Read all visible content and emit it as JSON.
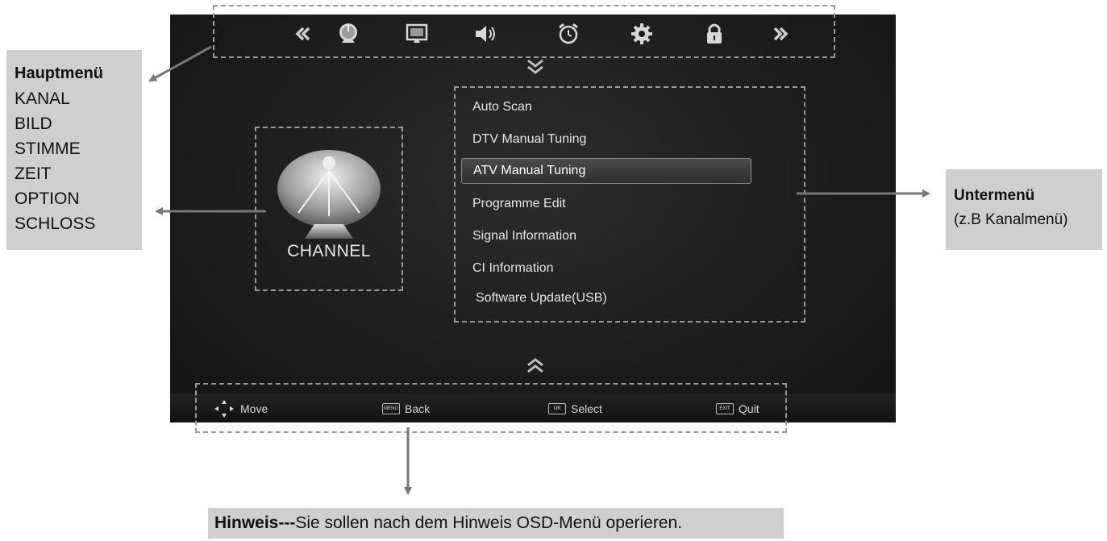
{
  "top_menu": {
    "icons": [
      "double-left-arrow-icon",
      "satellite-dish-icon",
      "monitor-picture-icon",
      "speaker-icon",
      "alarm-clock-icon",
      "gear-icon",
      "padlock-icon",
      "double-right-arrow-icon"
    ]
  },
  "left_panel": {
    "title": "CHANNEL",
    "icon": "satellite-dish-icon"
  },
  "submenu": {
    "items": [
      {
        "label": "Auto Scan",
        "selected": false
      },
      {
        "label": "DTV Manual Tuning",
        "selected": false
      },
      {
        "label": "ATV Manual Tuning",
        "selected": true
      },
      {
        "label": "Programme Edit",
        "selected": false
      },
      {
        "label": "Signal Information",
        "selected": false
      },
      {
        "label": "CI Information",
        "selected": false
      },
      {
        "label": "Software Update(USB)",
        "selected": false
      }
    ]
  },
  "footer": {
    "move_label": "Move",
    "back_label": "Back",
    "back_key": "MENU",
    "select_label": "Select",
    "select_key": "OK",
    "quit_label": "Quit",
    "quit_key": "EXIT"
  },
  "callouts": {
    "main_menu": {
      "heading": "Hauptmenü",
      "items": [
        "KANAL",
        "BILD",
        "STIMME",
        "ZEIT",
        "OPTION",
        "SCHLOSS"
      ]
    },
    "submenu": {
      "heading": "Untermenü",
      "note": "(z.B Kanalmenü)"
    },
    "hint": {
      "heading": "Hinweis---",
      "text": "Sie sollen nach dem Hinweis OSD-Menü operieren."
    }
  },
  "colors": {
    "screen_bg": "#1c1c1c",
    "callout_bg": "#cfcfcf",
    "dash": "#9a9a9a",
    "arrow": "#777777"
  }
}
